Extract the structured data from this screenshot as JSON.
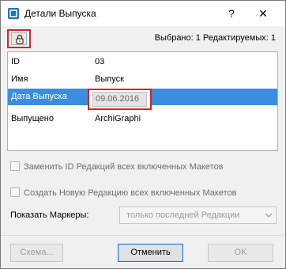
{
  "window": {
    "title": "Детали Выпуска",
    "help_label": "?",
    "close_label": "✕"
  },
  "toolbar": {
    "lock_icon": "padlock-icon",
    "selection_status": "Выбрано: 1 Редактируемых: 1"
  },
  "properties": [
    {
      "name": "ID",
      "value": "03"
    },
    {
      "name": "Имя",
      "value": "Выпуск"
    },
    {
      "name": "Дата Выпуска",
      "value": "09.06.2016"
    },
    {
      "name": "Выпущено",
      "value": "ArchiGraphi"
    }
  ],
  "options": {
    "replace_revision_id": "Заменить ID Редакций всех включенных Макетов",
    "create_new_revision": "Создать Новую Редакцию всех включенных Макетов"
  },
  "markers": {
    "label": "Показать Маркеры:",
    "selected": "только последней Редакции"
  },
  "buttons": {
    "scheme": "Схема...",
    "cancel": "Отменить",
    "ok": "OK"
  },
  "colors": {
    "highlight": "#e02020",
    "selection": "#3a8de0"
  }
}
